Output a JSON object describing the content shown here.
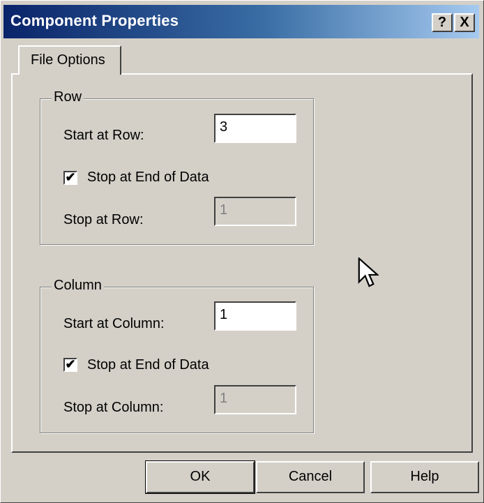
{
  "window": {
    "title": "Component Properties",
    "help_label": "?",
    "close_label": "X"
  },
  "tabs": [
    {
      "label": "File Options"
    }
  ],
  "row_group": {
    "legend": "Row",
    "start_label": "Start at Row:",
    "start_value": "3",
    "stop_end_label": "Stop at End of Data",
    "stop_end_checked": true,
    "stop_label": "Stop at Row:",
    "stop_value": "1"
  },
  "column_group": {
    "legend": "Column",
    "start_label": "Start at Column:",
    "start_value": "1",
    "stop_end_label": "Stop at End of Data",
    "stop_end_checked": true,
    "stop_label": "Stop at Column:",
    "stop_value": "1"
  },
  "buttons": {
    "ok": "OK",
    "cancel": "Cancel",
    "help": "Help"
  },
  "icons": {
    "checkmark": "✔",
    "pointer": "mouse-pointer-icon"
  },
  "colors": {
    "title_start": "#0a246a",
    "title_end": "#a6caf0",
    "face": "#d4d0c8"
  }
}
